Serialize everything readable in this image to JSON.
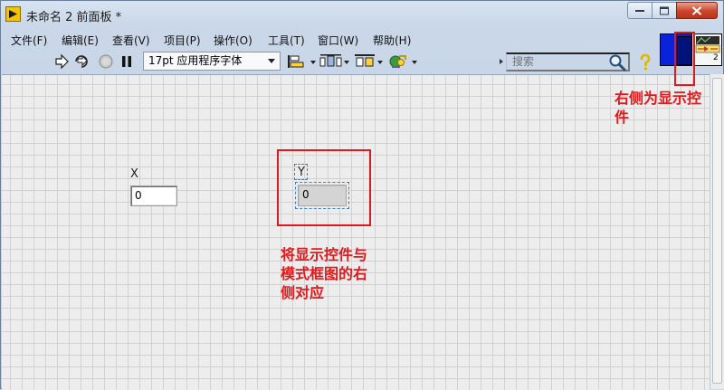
{
  "window": {
    "title": "未命名 2 前面板 *"
  },
  "menu": [
    {
      "label": "文件(F)"
    },
    {
      "label": "编辑(E)"
    },
    {
      "label": "查看(V)"
    },
    {
      "label": "项目(P)"
    },
    {
      "label": "操作(O)"
    },
    {
      "label": "工具(T)"
    },
    {
      "label": "窗口(W)"
    },
    {
      "label": "帮助(H)"
    }
  ],
  "toolbar": {
    "font_select": "17pt 应用程序字体",
    "search_placeholder": "搜索"
  },
  "icons": {
    "run": "run-arrow-icon",
    "run_continuous": "run-continuously-icon",
    "abort": "abort-icon",
    "pause": "pause-icon",
    "align": "align-objects-icon",
    "distribute": "distribute-objects-icon",
    "resize": "resize-objects-icon",
    "reorder": "reorder-icon",
    "search": "search-icon",
    "help": "help-icon"
  },
  "connector_pane": {
    "terminal_label": "2"
  },
  "front_panel": {
    "control_x": {
      "label": "X",
      "value": "0"
    },
    "indicator_y": {
      "label": "Y",
      "value": "0"
    }
  },
  "annotations": {
    "right_note": "右侧为显示控\n件",
    "center_note": "将显示控件与\n模式框图的右\n侧对应"
  },
  "colors": {
    "annotation_red": "#e0191c",
    "connector_blue": "#0a22d8",
    "selection_blue": "#3b7fc4"
  }
}
